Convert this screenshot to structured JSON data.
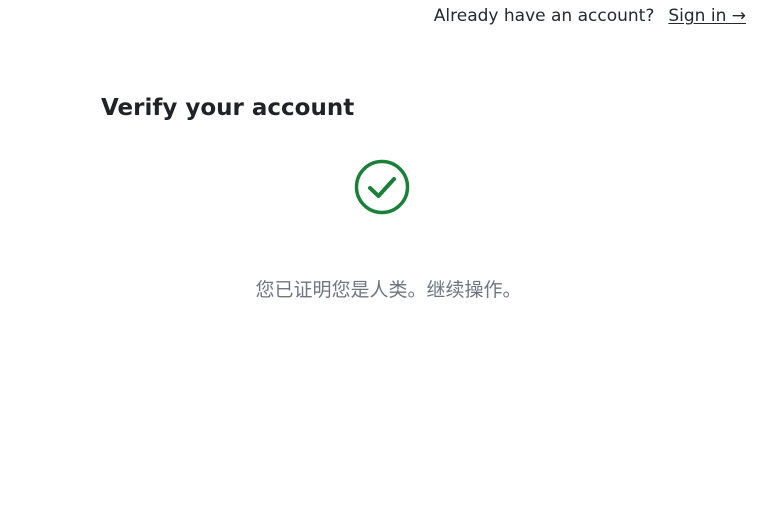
{
  "header": {
    "prompt_text": "Already have an account?",
    "sign_in_label": "Sign in →"
  },
  "main": {
    "title": "Verify your account",
    "status_icon": "check-circle-icon",
    "success_color": "#1a7f37",
    "message": "您已证明您是人类。继续操作。"
  }
}
